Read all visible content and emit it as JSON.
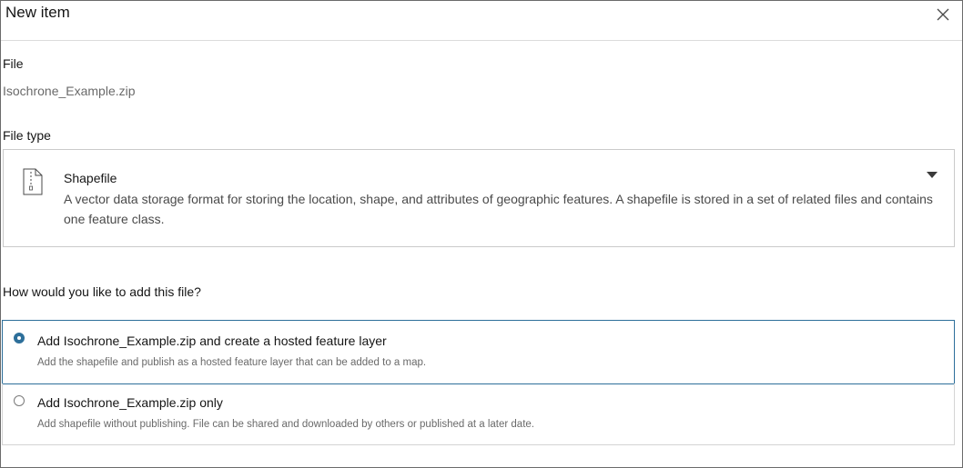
{
  "dialog": {
    "title": "New item",
    "close_icon": "close-icon"
  },
  "file": {
    "label": "File",
    "name": "Isochrone_Example.zip"
  },
  "file_type": {
    "label": "File type",
    "selected": {
      "icon": "file-icon",
      "title": "Shapefile",
      "description": "A vector data storage format for storing the location, shape, and attributes of geographic features. A shapefile is stored in a set of related files and contains one feature class."
    },
    "dropdown_icon": "caret-down-icon"
  },
  "add_options": {
    "question": "How would you like to add this file?",
    "options": [
      {
        "title": "Add Isochrone_Example.zip and create a hosted feature layer",
        "description": "Add the shapefile and publish as a hosted feature layer that can be added to a map.",
        "selected": true
      },
      {
        "title": "Add Isochrone_Example.zip only",
        "description": "Add shapefile without publishing. File can be shared and downloaded by others or published at a later date.",
        "selected": false
      }
    ]
  },
  "colors": {
    "accent": "#2d6f9a",
    "border": "#cacaca",
    "muted_text": "#6a6a6a"
  }
}
